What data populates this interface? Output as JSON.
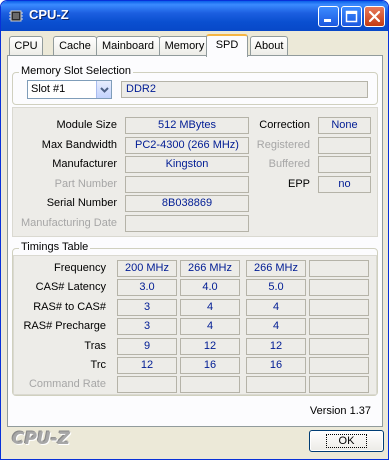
{
  "window": {
    "title": "CPU-Z",
    "icon": "cpu-chip-icon",
    "buttons": [
      "minimize-icon",
      "maximize-icon",
      "close-icon"
    ]
  },
  "tabs": [
    {
      "label": "CPU",
      "active": false
    },
    {
      "label": "Cache",
      "active": false
    },
    {
      "label": "Mainboard",
      "active": false
    },
    {
      "label": "Memory",
      "active": false
    },
    {
      "label": "SPD",
      "active": true
    },
    {
      "label": "About",
      "active": false
    }
  ],
  "slot_selection": {
    "title": "Memory Slot Selection",
    "selected_slot": "Slot #1",
    "memory_type": "DDR2"
  },
  "module": {
    "module_size_label": "Module Size",
    "module_size": "512 MBytes",
    "max_bandwidth_label": "Max Bandwidth",
    "max_bandwidth": "PC2-4300 (266 MHz)",
    "manufacturer_label": "Manufacturer",
    "manufacturer": "Kingston",
    "part_number_label": "Part Number",
    "part_number": "",
    "serial_number_label": "Serial Number",
    "serial_number": "8B038869",
    "manufacturing_date_label": "Manufacturing Date",
    "manufacturing_date": "",
    "correction_label": "Correction",
    "correction": "None",
    "registered_label": "Registered",
    "registered": "",
    "buffered_label": "Buffered",
    "buffered": "",
    "epp_label": "EPP",
    "epp": "no"
  },
  "timings": {
    "title": "Timings Table",
    "rows": [
      {
        "label": "Frequency",
        "values": [
          "200 MHz",
          "266 MHz",
          "266 MHz",
          ""
        ],
        "disabled": false
      },
      {
        "label": "CAS# Latency",
        "values": [
          "3.0",
          "4.0",
          "5.0",
          ""
        ],
        "disabled": false
      },
      {
        "label": "RAS# to CAS#",
        "values": [
          "3",
          "4",
          "4",
          ""
        ],
        "disabled": false
      },
      {
        "label": "RAS# Precharge",
        "values": [
          "3",
          "4",
          "4",
          ""
        ],
        "disabled": false
      },
      {
        "label": "Tras",
        "values": [
          "9",
          "12",
          "12",
          ""
        ],
        "disabled": false
      },
      {
        "label": "Trc",
        "values": [
          "12",
          "16",
          "16",
          ""
        ],
        "disabled": false
      },
      {
        "label": "Command Rate",
        "values": [
          "",
          "",
          "",
          ""
        ],
        "disabled": true
      }
    ]
  },
  "footer": {
    "version": "Version 1.37",
    "brand": "CPU-Z",
    "ok_label": "OK"
  },
  "colors": {
    "titlebar": "#0A4FD0",
    "value_text": "#001C94",
    "disabled_text": "#A6A6A6",
    "active_tab_accent": "#F5B543"
  }
}
